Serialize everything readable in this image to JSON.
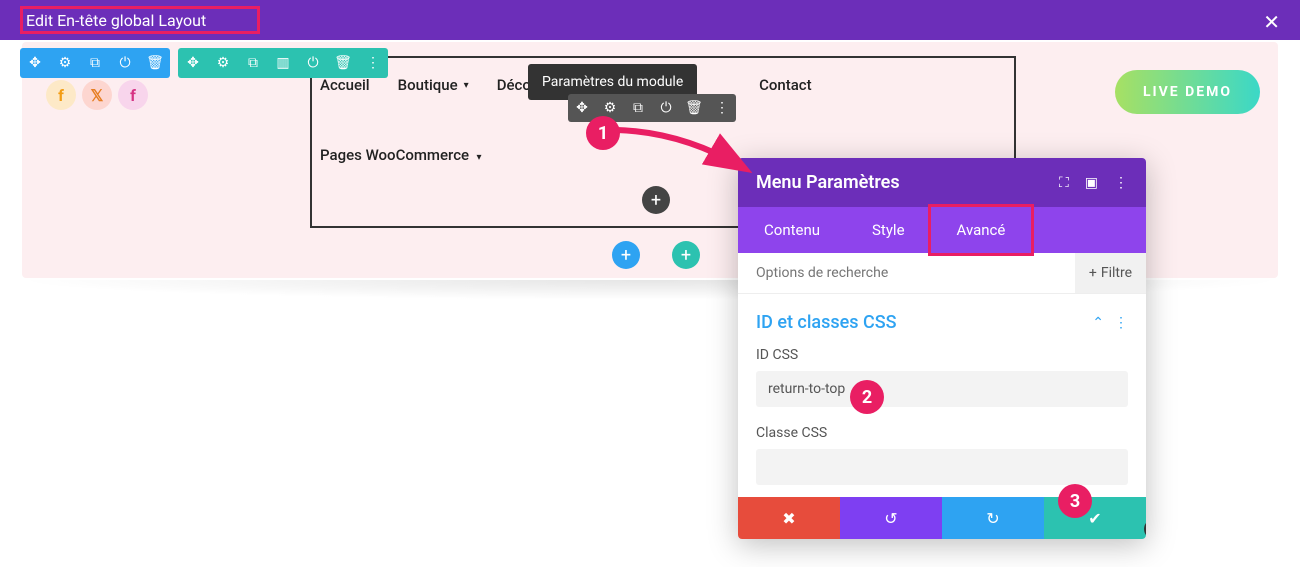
{
  "topbar": {
    "title": "Edit En-tête global Layout"
  },
  "tooltip": "Paramètres du module",
  "nav": {
    "items": [
      "Accueil",
      "Boutique",
      "Découvrir",
      "Contact"
    ],
    "woo": "Pages WooCommerce"
  },
  "live_demo": "LIVE DEMO",
  "markers": {
    "m1": "1",
    "m2": "2",
    "m3": "3"
  },
  "panel": {
    "title": "Menu Paramètres",
    "tabs": {
      "content": "Contenu",
      "style": "Style",
      "advanced": "Avancé"
    },
    "search_placeholder": "Options de recherche",
    "filter": "Filtre",
    "section_title": "ID et classes CSS",
    "id_label": "ID CSS",
    "id_value": "return-to-top",
    "class_label": "Classe CSS",
    "class_value": ""
  }
}
